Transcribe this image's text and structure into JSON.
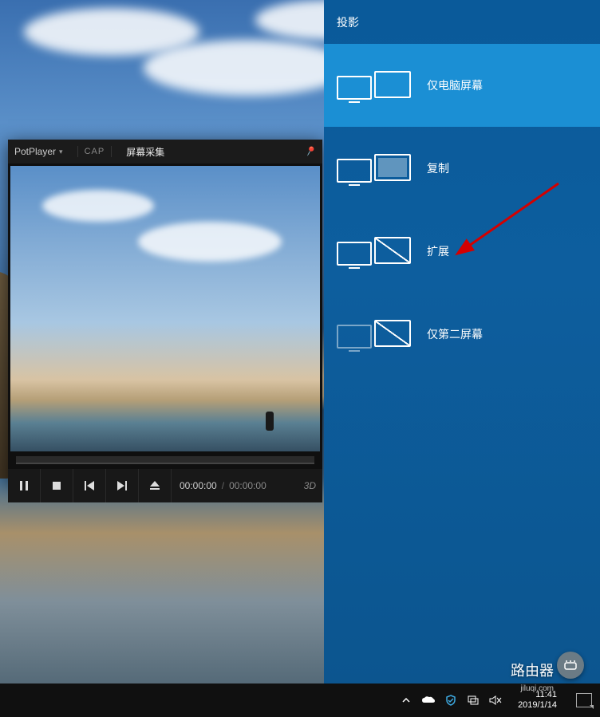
{
  "player": {
    "app_name": "PotPlayer",
    "capture_tag": "CAP",
    "title": "屏幕采集",
    "pin_glyph": "📌",
    "current_time": "00:00:00",
    "total_time": "00:00:00",
    "threeD_label": "3D",
    "buttons": {
      "play": "pause",
      "stop": "stop",
      "prev": "prev",
      "next": "next",
      "eject": "eject"
    }
  },
  "project_panel": {
    "title": "投影",
    "options": [
      {
        "id": "pc_only",
        "label": "仅电脑屏幕",
        "selected": true
      },
      {
        "id": "duplicate",
        "label": "复制",
        "selected": false
      },
      {
        "id": "extend",
        "label": "扩展",
        "selected": false
      },
      {
        "id": "second_only",
        "label": "仅第二屏幕",
        "selected": false
      }
    ]
  },
  "taskbar": {
    "time": "11:41",
    "date": "2019/1/14"
  },
  "watermark": {
    "text": "路由器",
    "sub": "jiluqi.com"
  },
  "annotation": {
    "arrow_target": "extend"
  }
}
